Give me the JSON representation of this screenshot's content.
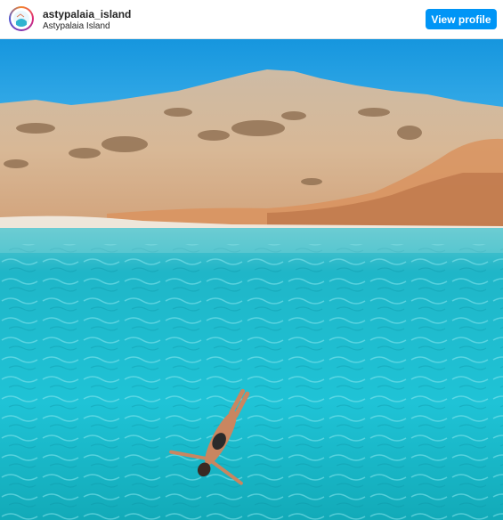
{
  "header": {
    "username": "astypalaia_island",
    "location": "Astypalaia Island",
    "view_profile_label": "View profile",
    "avatar_icon": "profile-avatar-icon"
  },
  "post": {
    "image_icon": "beach-swimmer-photo"
  },
  "colors": {
    "button": "#0095f6",
    "sea": "#29c6d6",
    "sky": "#1e9be0"
  }
}
